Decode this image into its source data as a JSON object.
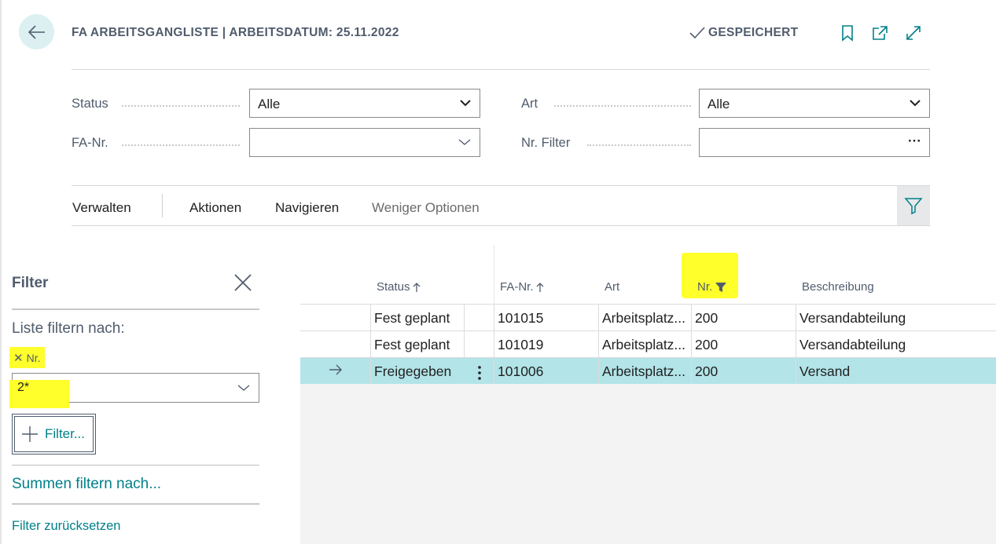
{
  "header": {
    "title": "FA ARBEITSGANGLISTE | ARBEITSDATUM: 25.11.2022",
    "saved_label": "GESPEICHERT"
  },
  "filters": {
    "status": {
      "label": "Status",
      "value": "Alle"
    },
    "art": {
      "label": "Art",
      "value": "Alle"
    },
    "fa_nr": {
      "label": "FA-Nr.",
      "value": ""
    },
    "nr_filter": {
      "label": "Nr. Filter",
      "value": "",
      "ellipsis": "···"
    }
  },
  "actions": {
    "verwalten": "Verwalten",
    "aktionen": "Aktionen",
    "navigieren": "Navigieren",
    "weniger": "Weniger Optionen"
  },
  "filter_pane": {
    "title": "Filter",
    "list_filter_label": "Liste filtern nach:",
    "chip_label": "Nr.",
    "chip_close": "✕",
    "field_value": "2*",
    "add_filter_label": "Filter...",
    "sum_filter_label": "Summen filtern nach...",
    "reset_label": "Filter zurücksetzen"
  },
  "grid": {
    "columns": {
      "status": "Status",
      "fa_nr": "FA-Nr.",
      "art": "Art",
      "nr": "Nr.",
      "beschreibung": "Beschreibung"
    },
    "rows": [
      {
        "status": "Fest geplant",
        "fa_nr": "101015",
        "art": "Arbeitsplatz...",
        "nr": "200",
        "beschreibung": "Versandabteilung"
      },
      {
        "status": "Fest geplant",
        "fa_nr": "101019",
        "art": "Arbeitsplatz...",
        "nr": "200",
        "beschreibung": "Versandabteilung"
      },
      {
        "status": "Freigegeben",
        "fa_nr": "101006",
        "art": "Arbeitsplatz...",
        "nr": "200",
        "beschreibung": "Versand"
      }
    ],
    "selected_row_index": 2
  },
  "colors": {
    "accent_teal": "#00808a",
    "selected_row": "#b2e4e8",
    "highlight_yellow": "#ffff2b",
    "back_button_bg": "#dcf0f1"
  }
}
